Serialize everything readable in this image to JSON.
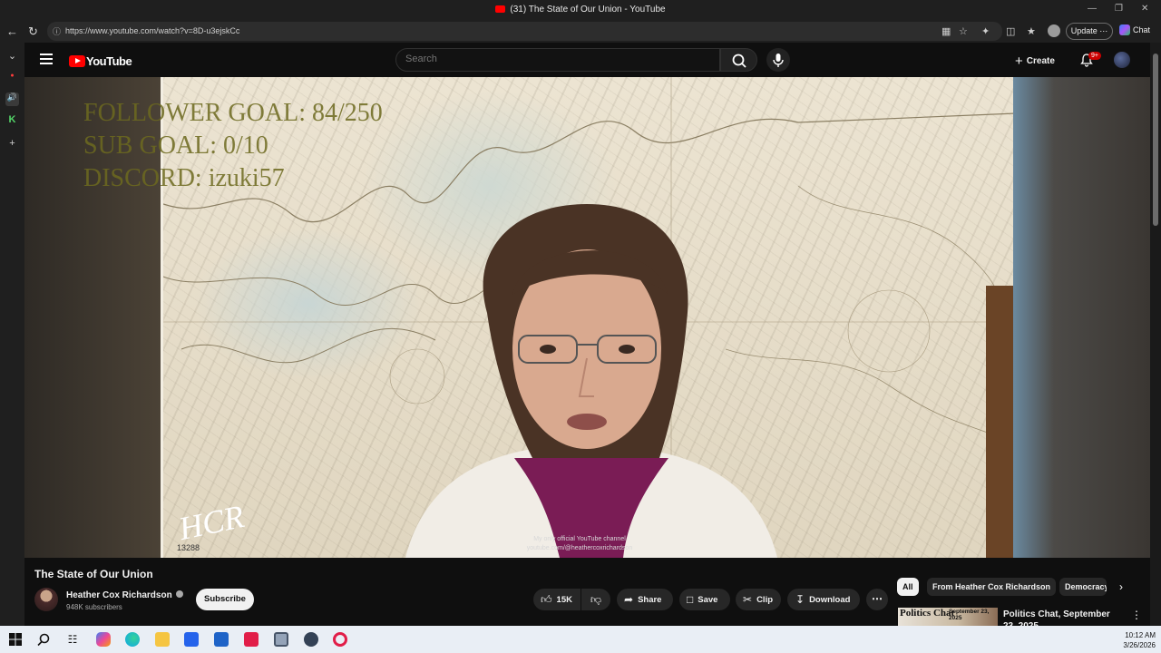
{
  "browser": {
    "tab_title": "(31) The State of Our Union - YouTube",
    "url": "https://www.youtube.com/watch?v=8D-u3ejskCc",
    "update_label": "Update",
    "chat_label": "Chat"
  },
  "youtube": {
    "logo_text": "YouTube",
    "search_placeholder": "Search",
    "create_label": "Create",
    "notification_count": "9+"
  },
  "video": {
    "overlay_lines": [
      "FOLLOWER GOAL:  84/250",
      "SUB GOAL: 0/10",
      "DISCORD: izuki57"
    ],
    "signature": "HCR",
    "map_number": "13288",
    "watermark_lines": [
      "My only official YouTube channel",
      "youtube.com/@heathercoxrichardson"
    ]
  },
  "details": {
    "title": "The State of Our Union",
    "channel_name": "Heather Cox Richardson",
    "subscribers": "948K subscribers",
    "subscribe_label": "Subscribe",
    "like_count": "15K",
    "share_label": "Share",
    "save_label": "Save",
    "clip_label": "Clip",
    "download_label": "Download"
  },
  "recommendations": {
    "chips": [
      "All",
      "From Heather Cox Richardson",
      "Democracy"
    ],
    "first": {
      "thumb_title": "Politics Chat",
      "thumb_date": "September 23, 2025",
      "title": "Politics Chat, September 23, 2025"
    }
  },
  "taskbar": {
    "time": "10:12 AM",
    "date": "3/26/2026"
  }
}
